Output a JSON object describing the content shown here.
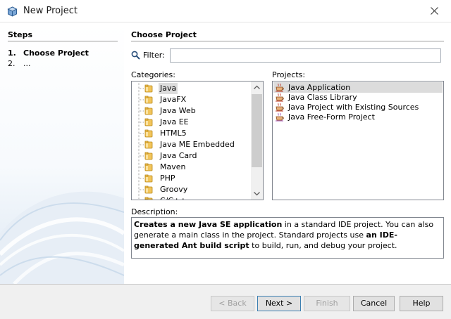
{
  "window": {
    "title": "New Project"
  },
  "steps": {
    "heading": "Steps",
    "items": [
      {
        "num": "1.",
        "label": "Choose Project"
      },
      {
        "num": "2.",
        "label": "..."
      }
    ]
  },
  "page": {
    "title": "Choose Project",
    "filter": {
      "label": "Filter:",
      "value": ""
    },
    "categories": {
      "label": "Categories:",
      "items": [
        "Java",
        "JavaFX",
        "Java Web",
        "Java EE",
        "HTML5",
        "Java ME Embedded",
        "Java Card",
        "Maven",
        "PHP",
        "Groovy",
        "C/C++"
      ],
      "selected": "Java"
    },
    "projects": {
      "label": "Projects:",
      "items": [
        "Java Application",
        "Java Class Library",
        "Java Project with Existing Sources",
        "Java Free-Form Project"
      ],
      "selected": "Java Application"
    },
    "description": {
      "label": "Description:",
      "parts": [
        {
          "text": "Creates a new Java SE application",
          "bold": true
        },
        {
          "text": " in a standard IDE project. You can also generate a main class in the project. Standard projects use ",
          "bold": false
        },
        {
          "text": "an IDE-generated Ant build script",
          "bold": true
        },
        {
          "text": " to build, run, and debug your project.",
          "bold": false
        }
      ]
    }
  },
  "buttons": {
    "back": "< Back",
    "next": "Next >",
    "finish": "Finish",
    "cancel": "Cancel",
    "help": "Help"
  },
  "icons": {
    "app": "cube-icon",
    "close": "close-icon",
    "filter": "magnifier-icon",
    "category": "folder-icon",
    "project": "coffee-cup-icon"
  },
  "colors": {
    "selection": "#dcdcdc",
    "folder": "#e8b23c",
    "footer": "#f0f0f0"
  }
}
